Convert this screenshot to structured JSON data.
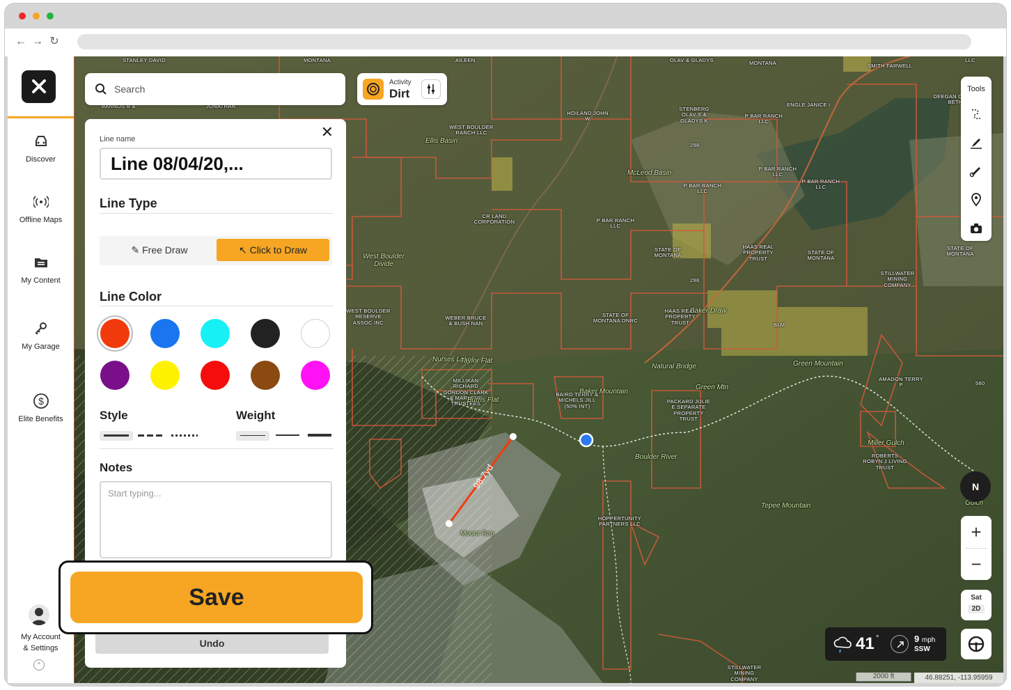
{
  "rail": {
    "items": [
      {
        "label": "Discover",
        "icon": "discover-icon"
      },
      {
        "label": "Offline Maps",
        "icon": "offline-maps-icon"
      },
      {
        "label": "My Content",
        "icon": "folder-icon"
      },
      {
        "label": "My Garage",
        "icon": "keys-icon"
      },
      {
        "label": "Elite Benefits",
        "icon": "dollar-icon"
      }
    ],
    "account_label_1": "My Account",
    "account_label_2": "& Settings"
  },
  "search": {
    "placeholder": "Search"
  },
  "activity": {
    "label": "Activity",
    "value": "Dirt"
  },
  "panel": {
    "line_name_label": "Line name",
    "line_name_value": "Line 08/04/20,...",
    "line_type_title": "Line Type",
    "free_draw_label": "Free Draw",
    "click_to_draw_label": "Click to Draw",
    "line_color_title": "Line Color",
    "colors": [
      "#f23b0c",
      "#1976f0",
      "#17f0f5",
      "#222222",
      "#ffffff",
      "#7a0f8a",
      "#fff200",
      "#f50d0d",
      "#8a4a12",
      "#ff12f5"
    ],
    "selected_color": "#f23b0c",
    "style_title": "Style",
    "weight_title": "Weight",
    "notes_title": "Notes",
    "notes_placeholder": "Start typing...",
    "save_label": "Save",
    "undo_label": "Undo"
  },
  "tools": {
    "label": "Tools"
  },
  "map": {
    "measure_label": "98.7yd",
    "labels": [
      "STANLEY DAVID",
      "MONTANA",
      "AILEEN",
      "OLAV & GLADYS",
      "MONTANA",
      "SMITH FARWELL",
      "LLC",
      "BANNOS B &",
      "JONATHAN",
      "HOILAND JOHN W",
      "STENBERG OLAV S & GLADYS K",
      "P BAR RANCH LLC",
      "ENGLE JANICE I",
      "DEEGAN CAROL BETH",
      "WEST BOULDER RANCH LLC",
      "Ellis Basin",
      "McLeod Basin",
      "P BAR RANCH LLC",
      "P BAR RANCH LLC",
      "P BAR RANCH LLC",
      "CR LAND CORPORATION",
      "P BAR RANCH LLC",
      "STATE OF MONTANA",
      "HAAS REAL PROPERTY TRUST",
      "STATE OF MONTANA",
      "STATE OF MONTANA",
      "STILLWATER MINING COMPANY",
      "West Boulder Divide",
      "WEST BOULDER RESERVE ASSOC INC",
      "WEBER BRUCE & BUSH NAN",
      "STATE OF MONTANA DNRC",
      "HAAS REAL PROPERTY TRUST",
      "Baker Draw",
      "BLM",
      "Green Mountain",
      "AMADON TERRY P",
      "560",
      "Nurses Lakes",
      "Taylor Flat",
      "MILLIKAN RICHARD GORDON CLARK & MARLENE TRUSTEES",
      "Burris Flat",
      "BAIRD TERRY & MICHELS JILL (50% INT)",
      "Baker Mountain",
      "Natural Bridge",
      "Green Mtn",
      "PACKARD JULIE E SEPARATE PROPERTY TRUST",
      "Boulder River",
      "HOPPERTUNITY PARTNERS LLC",
      "ROBERTS ROBYN J LIVING TRUST",
      "Miller Gulch",
      "Mount Rae",
      "Tepee Mountain",
      "Gulch",
      "STILLWATER MINING COMPANY",
      "298",
      "298"
    ]
  },
  "weather": {
    "temp": "41",
    "deg": "°",
    "wind_speed": "9",
    "wind_unit": "mph",
    "wind_dir": "SSW"
  },
  "map_controls": {
    "compass": "N",
    "layer_top": "Sat",
    "layer_bottom": "2D"
  },
  "scale_label": "2000 ft",
  "coords": "46.88251, -113.95959"
}
